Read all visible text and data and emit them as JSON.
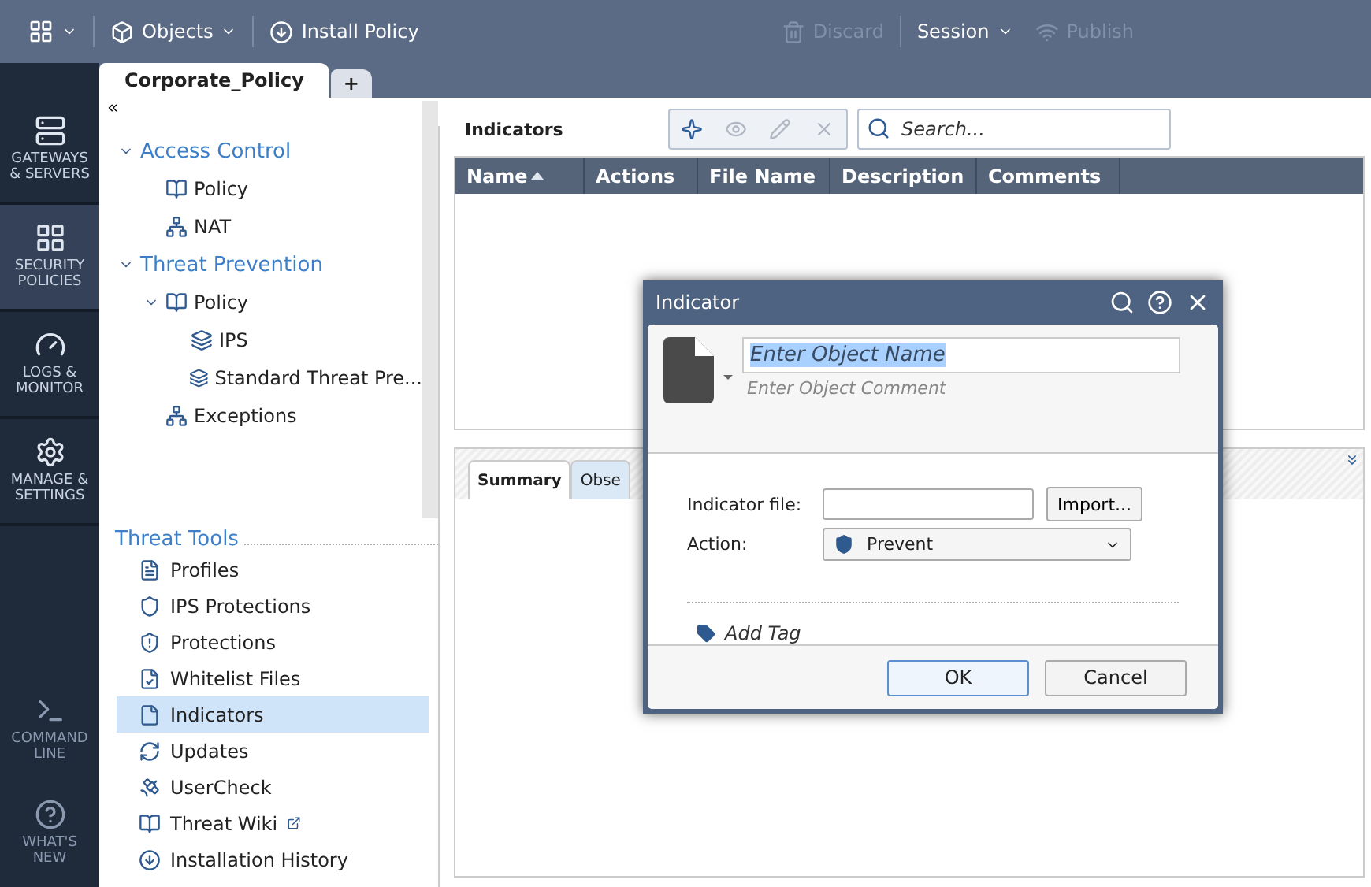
{
  "toolbar": [
    {
      "kind": "menu",
      "label": "Objects",
      "disabled": false
    },
    {
      "kind": "button",
      "label": "Install Policy",
      "disabled": false
    },
    {
      "kind": "button",
      "label": "Discard",
      "disabled": true
    },
    {
      "kind": "menu",
      "label": "Session",
      "disabled": false
    },
    {
      "kind": "button",
      "label": "Publish",
      "disabled": true
    }
  ],
  "policy_tabs": [
    {
      "label": "Corporate_Policy",
      "selected": true
    },
    {
      "label": "+",
      "selected": false
    }
  ],
  "nav": [
    {
      "label": "GATEWAYS & SERVERS",
      "selected": false
    },
    {
      "label": "SECURITY POLICIES",
      "selected": true
    },
    {
      "label": "LOGS & MONITOR",
      "selected": false
    },
    {
      "label": "MANAGE & SETTINGS",
      "selected": false
    }
  ],
  "nav_bottom": [
    {
      "label": "COMMAND LINE"
    },
    {
      "label": "WHAT'S NEW"
    }
  ],
  "tree": [
    {
      "label": "Access Control",
      "expanded": true,
      "children": [
        {
          "label": "Policy"
        },
        {
          "label": "NAT"
        }
      ]
    },
    {
      "label": "Threat Prevention",
      "expanded": true,
      "children": [
        {
          "label": "Policy",
          "expanded": true,
          "children": [
            {
              "label": "IPS"
            },
            {
              "label": "Standard Threat Pre..."
            }
          ]
        },
        {
          "label": "Exceptions"
        }
      ]
    }
  ],
  "threat_tools": {
    "title": "Threat Tools",
    "items": [
      {
        "label": "Profiles",
        "selected": false
      },
      {
        "label": "IPS Protections",
        "selected": false
      },
      {
        "label": "Protections",
        "selected": false
      },
      {
        "label": "Whitelist Files",
        "selected": false
      },
      {
        "label": "Indicators",
        "selected": true
      },
      {
        "label": "Updates",
        "selected": false
      },
      {
        "label": "UserCheck",
        "selected": false
      },
      {
        "label": "Threat Wiki",
        "selected": false
      },
      {
        "label": "Installation History",
        "selected": false
      }
    ]
  },
  "main": {
    "title": "Indicators",
    "actions": [
      {
        "disabled": false
      },
      {
        "disabled": true
      },
      {
        "disabled": true
      },
      {
        "disabled": true
      }
    ],
    "search": {
      "placeholder": "Search..."
    },
    "columns": [
      {
        "label": "Name",
        "sorted": true
      },
      {
        "label": "Actions",
        "sorted": false
      },
      {
        "label": "File Name",
        "sorted": false
      },
      {
        "label": "Description",
        "sorted": false
      },
      {
        "label": "Comments",
        "sorted": false
      }
    ],
    "detail_tabs": [
      {
        "label": "Summary",
        "selected": true
      },
      {
        "label": "Obse",
        "selected": false
      }
    ]
  },
  "dialog": {
    "title": "Indicator",
    "name": "Enter Object Name",
    "name_selected": true,
    "comment_placeholder": "Enter Object Comment",
    "file_label": "Indicator file:",
    "import": "Import...",
    "action_label": "Action:",
    "action_value": "Prevent",
    "add_tag": "Add Tag",
    "buttons": [
      {
        "label": "OK",
        "default": true
      },
      {
        "label": "Cancel",
        "default": false
      }
    ]
  }
}
